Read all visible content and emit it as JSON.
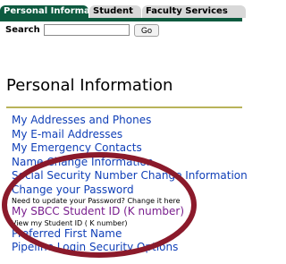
{
  "tabs": [
    {
      "label": "Personal Information"
    },
    {
      "label": "Student"
    },
    {
      "label": "Faculty Services"
    }
  ],
  "search": {
    "label": "Search",
    "value": "",
    "go_label": "Go"
  },
  "page": {
    "title": "Personal Information"
  },
  "menu": {
    "items": [
      {
        "label": "My Addresses and Phones"
      },
      {
        "label": "My E-mail Addresses"
      },
      {
        "label": "My Emergency Contacts"
      },
      {
        "label": "Name Change Information"
      },
      {
        "label": "Social Security Number Change Information"
      },
      {
        "label": "Change your Password",
        "description": "Need to update your Password? Change it here"
      },
      {
        "label": "My SBCC Student ID (K number)",
        "description": "View my Student ID ( K number)"
      },
      {
        "label": "Preferred First Name"
      },
      {
        "label": "Pipeline Login Security Options"
      }
    ]
  },
  "colors": {
    "active_tab": "#0d5a3f",
    "link": "#1140b8",
    "visited_link": "#7a1f8e",
    "title_rule": "#b9b35a",
    "highlight_ring": "#8b1a2b"
  }
}
